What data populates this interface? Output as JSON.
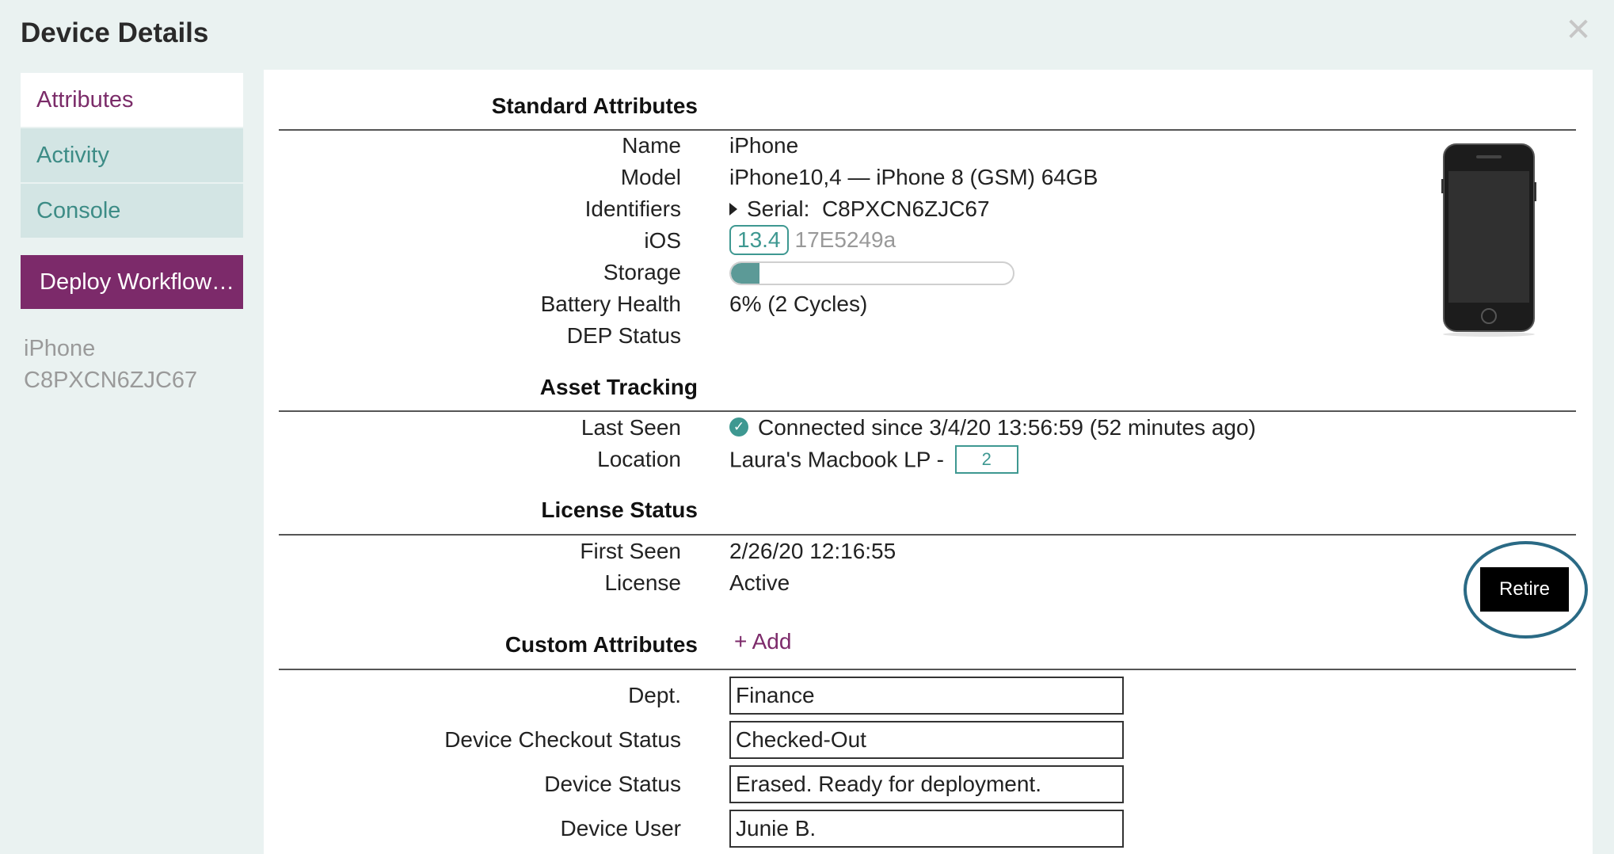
{
  "window": {
    "title": "Device Details"
  },
  "sidebar": {
    "items": [
      {
        "label": "Attributes",
        "active": true
      },
      {
        "label": "Activity",
        "active": false
      },
      {
        "label": "Console",
        "active": false
      }
    ],
    "deploy_label": "Deploy Workflow…",
    "device_name": "iPhone",
    "device_serial": "C8PXCN6ZJC67"
  },
  "standard": {
    "title": "Standard Attributes",
    "name_label": "Name",
    "name_value": "iPhone",
    "model_label": "Model",
    "model_value": "iPhone10,4 — iPhone 8 (GSM) 64GB",
    "identifiers_label": "Identifiers",
    "serial_prefix": "Serial:",
    "serial_value": "C8PXCN6ZJC67",
    "ios_label": "iOS",
    "ios_version": "13.4",
    "ios_build": "17E5249a",
    "storage_label": "Storage",
    "storage_used_fraction": 0.1,
    "battery_label": "Battery Health",
    "battery_value": "6% (2 Cycles)",
    "dep_label": "DEP Status"
  },
  "asset": {
    "title": "Asset Tracking",
    "last_seen_label": "Last Seen",
    "last_seen_value": "Connected since 3/4/20 13:56:59 (52 minutes ago)",
    "location_label": "Location",
    "location_value": "Laura's Macbook LP -",
    "location_count": "2"
  },
  "license": {
    "title": "License Status",
    "first_seen_label": "First Seen",
    "first_seen_value": "2/26/20 12:16:55",
    "license_label": "License",
    "license_value": "Active",
    "retire_label": "Retire"
  },
  "custom": {
    "title": "Custom Attributes",
    "add_label": "+ Add",
    "fields": [
      {
        "label": "Dept.",
        "value": "Finance"
      },
      {
        "label": "Device Checkout Status",
        "value": "Checked-Out"
      },
      {
        "label": "Device Status",
        "value": "Erased. Ready for deployment."
      },
      {
        "label": "Device User",
        "value": "Junie B."
      }
    ]
  },
  "colors": {
    "accent_purple": "#7c2a6a",
    "teal": "#3e9891",
    "background": "#eaf2f1"
  },
  "icons": {
    "close": "close-icon",
    "check": "check-circle-icon",
    "disclosure": "disclosure-triangle-icon",
    "device": "iphone-icon"
  }
}
